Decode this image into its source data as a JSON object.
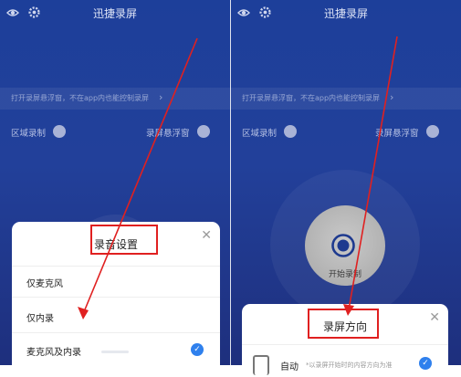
{
  "app_title": "迅捷录屏",
  "notice_text": "打开录屏悬浮窗，不在app内也能控制录屏",
  "options": {
    "region": "区域录制",
    "floating": "录屏悬浮窗"
  },
  "left_sheet": {
    "title": "录音设置",
    "choices": [
      "仅麦克风",
      "仅内录",
      "麦克风及内录"
    ],
    "selected": "麦克风及内录"
  },
  "right_panel": {
    "start_label": "开始录制",
    "sheet": {
      "title": "录屏方向",
      "auto_label": "自动",
      "auto_desc": "*以录屏开始时的内容方向为准"
    }
  },
  "colors": {
    "annotation": "#e02020",
    "accent": "#2f80ed",
    "background": "#1d3f9a"
  },
  "icons": [
    "eye-icon",
    "gear-icon",
    "chevron-right-icon",
    "close-icon",
    "check-icon",
    "record-icon",
    "phone-icon"
  ]
}
